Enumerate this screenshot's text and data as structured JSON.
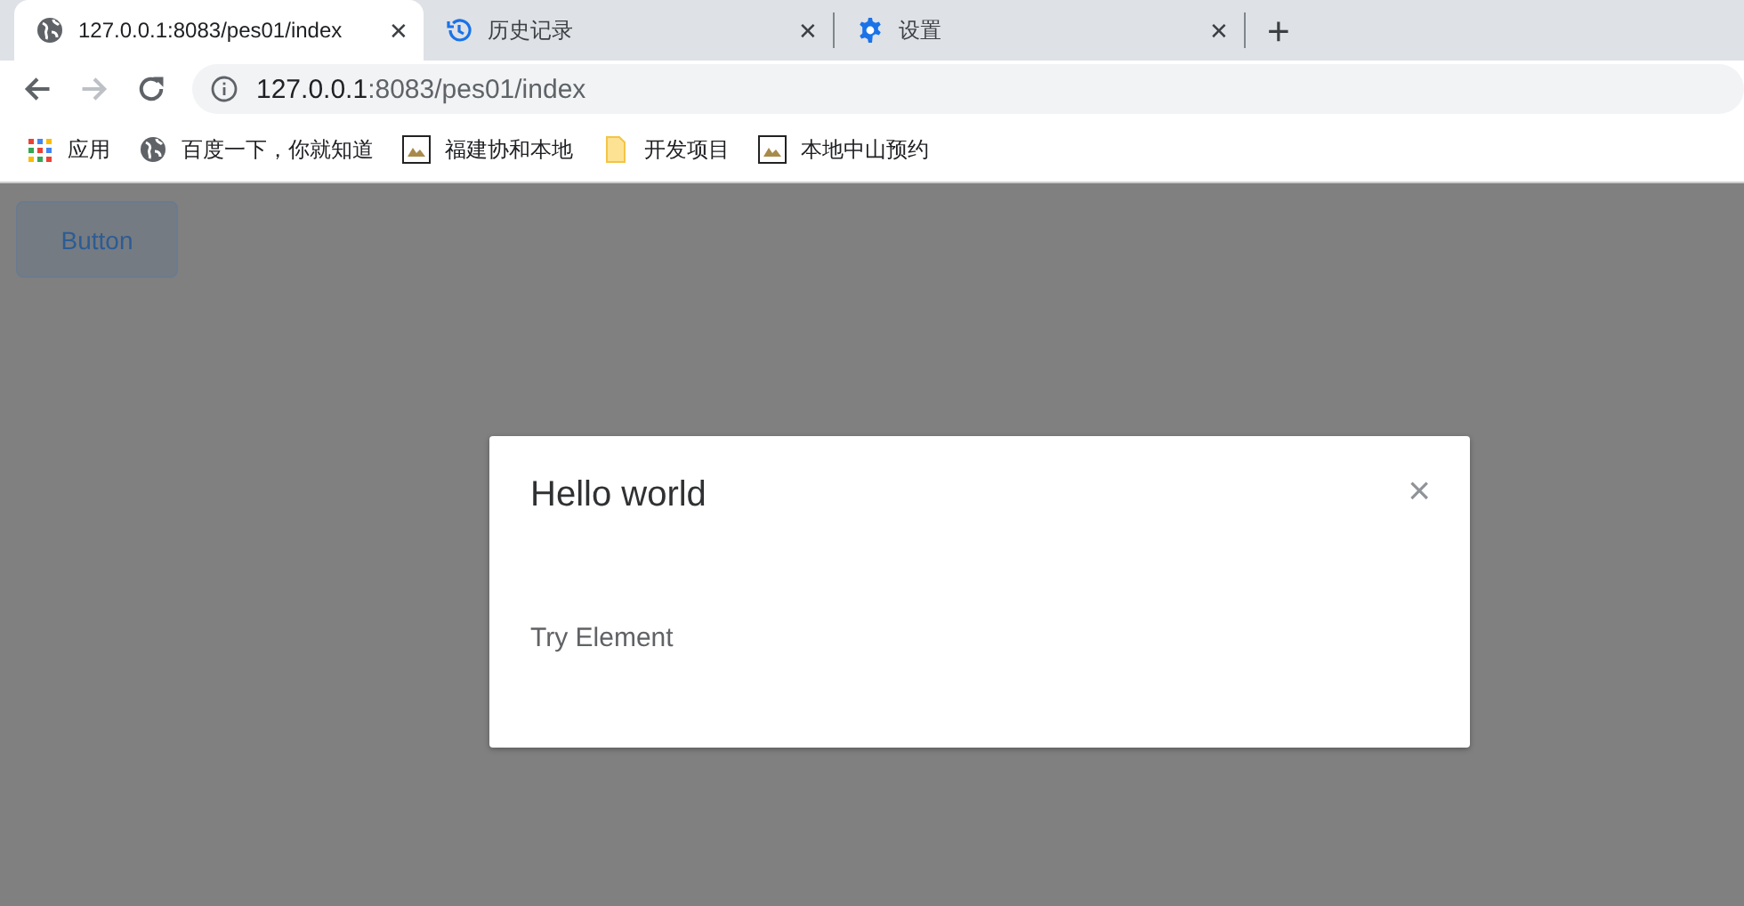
{
  "tabs": [
    {
      "title": "127.0.0.1:8083/pes01/index",
      "kind": "globe",
      "selected": true,
      "close": "✕"
    },
    {
      "title": "历史记录",
      "kind": "history",
      "selected": false,
      "close": "✕"
    },
    {
      "title": "设置",
      "kind": "gear",
      "selected": false,
      "close": "✕"
    }
  ],
  "new_tab": "+",
  "address": {
    "host": "127.0.0.1",
    "path": ":8083/pes01/index"
  },
  "bookmarks": [
    {
      "label": "应用",
      "kind": "apps"
    },
    {
      "label": "百度一下，你就知道",
      "kind": "globe"
    },
    {
      "label": "福建协和本地",
      "kind": "image"
    },
    {
      "label": "开发项目",
      "kind": "folder"
    },
    {
      "label": "本地中山预约",
      "kind": "image"
    }
  ],
  "page": {
    "button": "Button"
  },
  "dialog": {
    "title": "Hello world",
    "close": "×",
    "body": "Try Element"
  }
}
